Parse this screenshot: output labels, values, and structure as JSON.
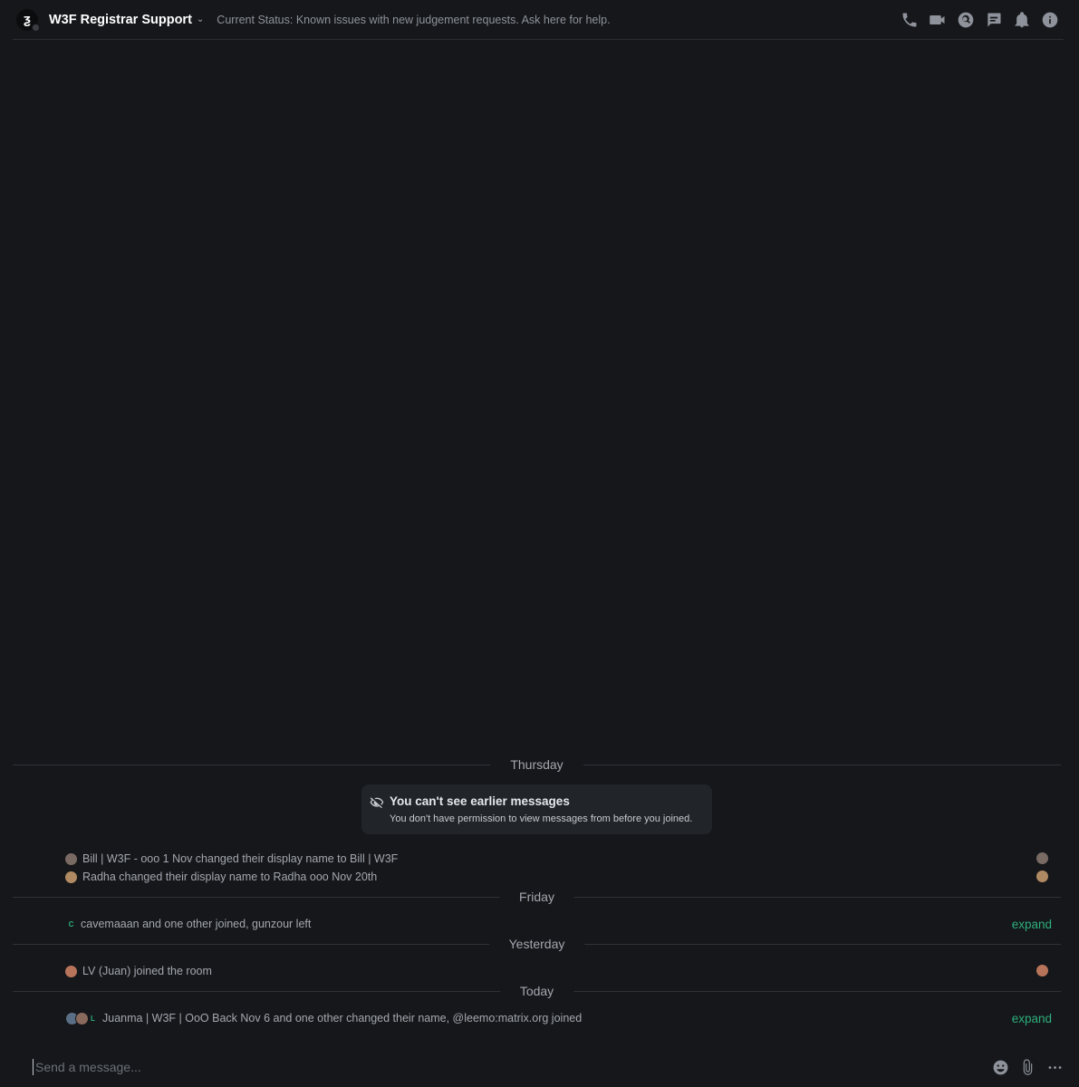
{
  "header": {
    "room_name": "W3F Registrar Support",
    "topic": "Current Status: Known issues with new judgement requests. Ask here for help.",
    "icons": [
      "phone-icon",
      "video-icon",
      "search-icon",
      "threads-icon",
      "bell-icon",
      "info-icon"
    ]
  },
  "timeline": {
    "separators": [
      "Thursday",
      "Friday",
      "Yesterday",
      "Today"
    ],
    "notice": {
      "title": "You can't see earlier messages",
      "body": "You don't have permission to view messages from before you joined."
    },
    "events": [
      {
        "text": "Bill | W3F - ooo 1 Nov changed their display name to Bill | W3F",
        "avatar_color": "#7a6a64"
      },
      {
        "text": "Radha changed their display name to Radha ooo Nov 20th",
        "avatar_color": "#b08a62"
      },
      {
        "text": "cavemaaan and one other joined, gunzour left",
        "avatar_letter": "C",
        "expand_label": "expand"
      },
      {
        "text": "LV (Juan) joined the room",
        "avatar_color": "#b8745a"
      },
      {
        "text": "Juanma | W3F | OoO Back Nov 6 and one other changed their name, @leemo:matrix.org joined",
        "avatar_letter": "L",
        "expand_label": "expand"
      }
    ]
  },
  "composer": {
    "placeholder": "Send a message...",
    "icons": [
      "emoji-icon",
      "attachment-icon",
      "more-options-icon"
    ]
  }
}
